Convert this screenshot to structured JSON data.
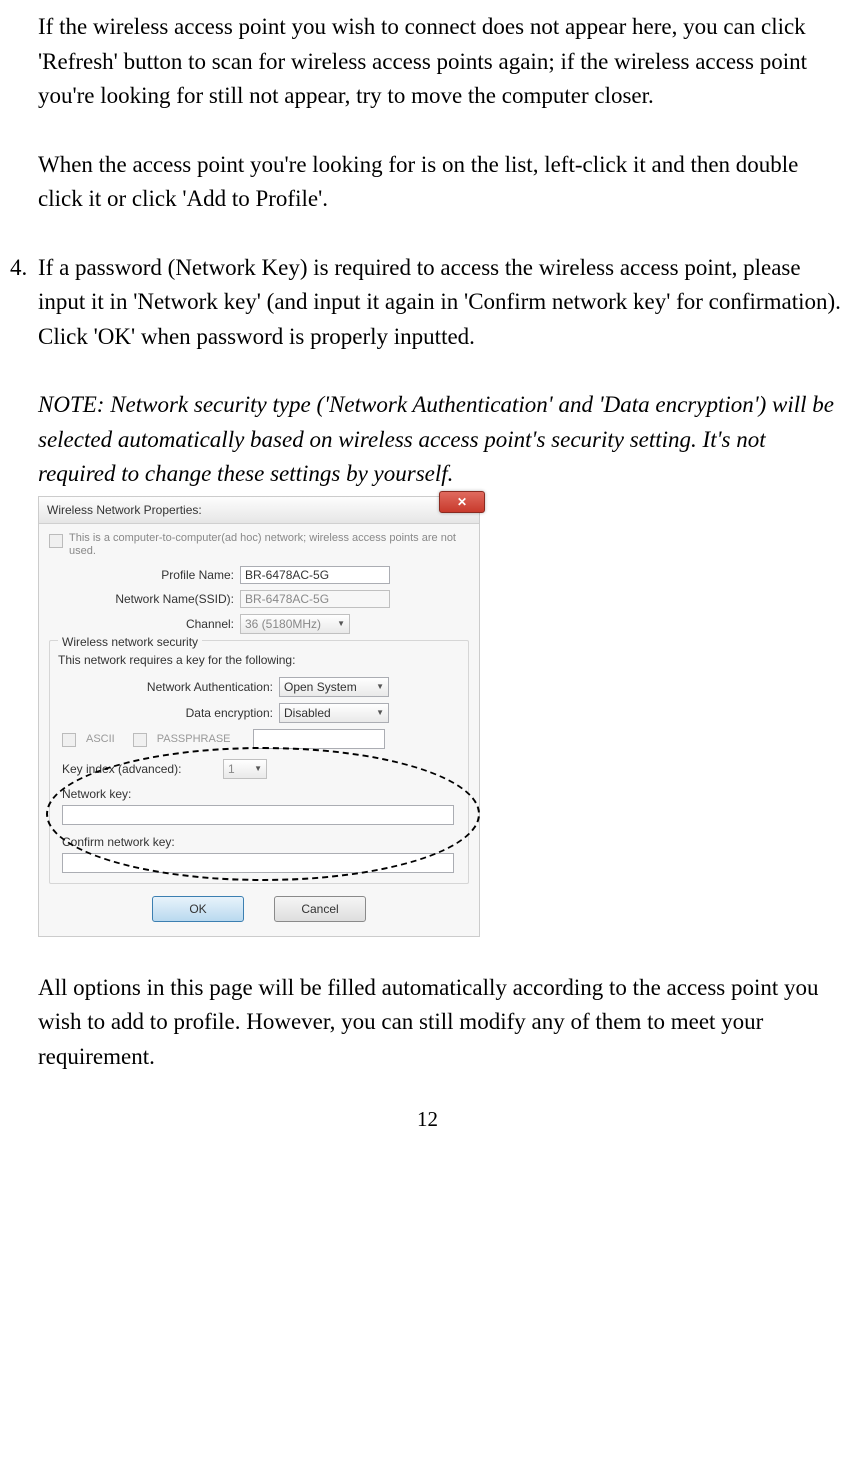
{
  "paragraphs": {
    "p1": "If the wireless access point you wish to connect does not appear here, you can click 'Refresh' button to scan for wireless access points again; if the wireless access point you're looking for still not appear, try to move the computer closer.",
    "p2": "When the access point you're looking for is on the list, left-click it and then double click it or click 'Add to Profile'.",
    "item4_num": "4.",
    "p3": "If a password (Network Key) is required to access the wireless access point, please input it in 'Network key' (and input it again in 'Confirm network key' for confirmation). Click 'OK' when password is properly inputted.",
    "note": "NOTE: Network security type ('Network Authentication' and 'Data encryption') will be selected automatically based on wireless access point's security setting. It's not required to change these settings by yourself.",
    "p4": "All options in this page will be filled automatically according to the access point you wish to add to profile. However, you can still modify any of them to meet your requirement."
  },
  "dialog": {
    "title": "Wireless Network Properties:",
    "adhoc": "This is a computer-to-computer(ad hoc) network; wireless access points are not used.",
    "profile_label": "Profile Name:",
    "profile_value": "BR-6478AC-5G",
    "ssid_label": "Network Name(SSID):",
    "ssid_value": "BR-6478AC-5G",
    "channel_label": "Channel:",
    "channel_value": "36 (5180MHz)",
    "group_title": "Wireless network security",
    "group_note": "This network requires a key for the following:",
    "auth_label": "Network Authentication:",
    "auth_value": "Open System",
    "enc_label": "Data encryption:",
    "enc_value": "Disabled",
    "ascii": "ASCII",
    "passphrase": "PASSPHRASE",
    "keyidx_label": "Key index (advanced):",
    "keyidx_value": "1",
    "netkey_label": "Network key:",
    "confirm_label": "Confirm network key:",
    "ok": "OK",
    "cancel": "Cancel"
  },
  "page_number": "12"
}
